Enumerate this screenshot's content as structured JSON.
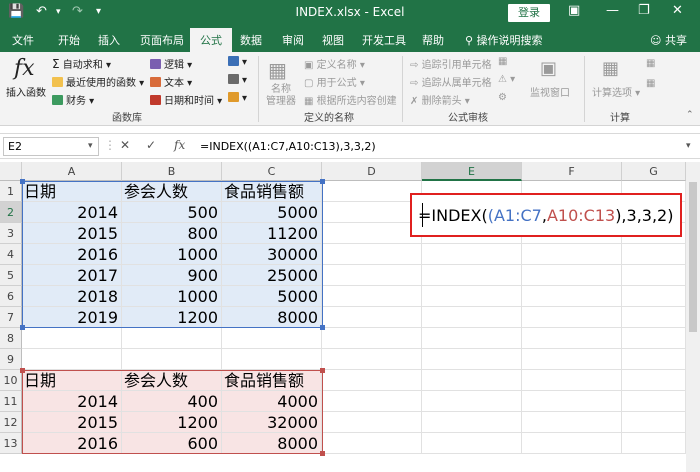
{
  "titlebar": {
    "title": "INDEX.xlsx  -  Excel",
    "login_label": "登录",
    "bg_color": "#217346"
  },
  "menu": {
    "tabs": [
      "文件",
      "开始",
      "插入",
      "页面布局",
      "公式",
      "数据",
      "审阅",
      "视图",
      "开发工具",
      "帮助"
    ],
    "active_tab": "公式",
    "search_label": "操作说明搜索",
    "share_label": "共享"
  },
  "ribbon": {
    "insert_function": "插入函数",
    "autosum": "自动求和",
    "recent": "最近使用的函数",
    "finance": "财务",
    "logic": "逻辑",
    "text": "文本",
    "datetime": "日期和时间",
    "group1": "函数库",
    "name_manager": "名称\n管理器",
    "define_name": "定义名称",
    "use_in_formula": "用于公式",
    "create_from_sel": "根据所选内容创建",
    "group2": "定义的名称",
    "trace_precedents": "追踪引用单元格",
    "trace_dependents": "追踪从属单元格",
    "remove_arrows": "删除箭头",
    "watch_window": "监视窗口",
    "group3": "公式审核",
    "calc_options": "计算选项",
    "group4": "计算"
  },
  "formula_bar": {
    "name_box": "E2",
    "formula": "=INDEX((A1:C7,A10:C13),3,3,2)"
  },
  "grid": {
    "columns": [
      "A",
      "B",
      "C",
      "D",
      "E",
      "F",
      "G"
    ],
    "selected_column": "E",
    "selected_row": "2",
    "rows": [
      "1",
      "2",
      "3",
      "4",
      "5",
      "6",
      "7",
      "8",
      "9",
      "10",
      "11",
      "12",
      "13"
    ],
    "table1": {
      "headers": [
        "日期",
        "参会人数",
        "食品销售额"
      ],
      "data": [
        [
          "2014",
          "500",
          "5000"
        ],
        [
          "2015",
          "800",
          "11200"
        ],
        [
          "2016",
          "1000",
          "30000"
        ],
        [
          "2017",
          "900",
          "25000"
        ],
        [
          "2018",
          "1000",
          "5000"
        ],
        [
          "2019",
          "1200",
          "8000"
        ]
      ]
    },
    "table2": {
      "headers": [
        "日期",
        "参会人数",
        "食品销售额"
      ],
      "data": [
        [
          "2014",
          "400",
          "4000"
        ],
        [
          "2015",
          "1200",
          "32000"
        ],
        [
          "2016",
          "600",
          "8000"
        ]
      ]
    }
  },
  "edit_cell": {
    "prefix": "=INDEX(",
    "paren_open": "(",
    "ref1": "A1:C7",
    "comma": ",",
    "ref2": "A10:C13",
    "rest": "),3,3,2)",
    "ref1_color": "#4472c4",
    "ref2_color": "#c0504d",
    "highlight_color": "#e0201f"
  }
}
